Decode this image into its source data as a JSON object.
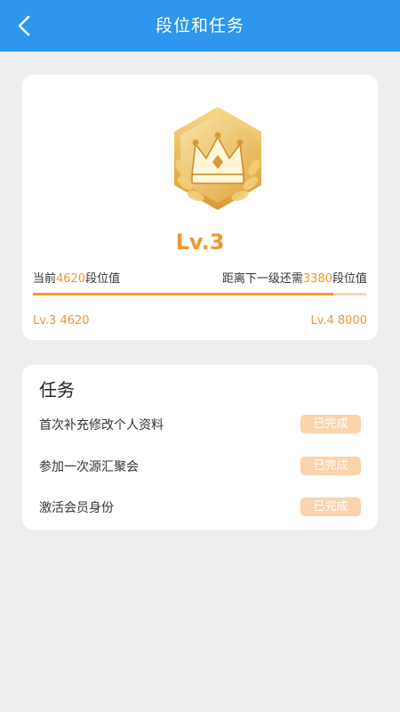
{
  "header": {
    "title": "段位和任务"
  },
  "level": {
    "name": "Lv.3",
    "current_prefix": "当前",
    "current_value": "4620",
    "current_suffix": "段位值",
    "next_prefix": "距离下一级还需",
    "next_value": "3380",
    "next_suffix": "段位值",
    "progress_fraction": 0.9,
    "min_label": "Lv.3 4620",
    "max_label": "Lv.4 8000"
  },
  "tasks": {
    "title": "任务",
    "items": [
      {
        "label": "首次补充修改个人资料",
        "status": "已完成"
      },
      {
        "label": "参加一次源汇聚会",
        "status": "已完成"
      },
      {
        "label": "激活会员身份",
        "status": "已完成"
      }
    ]
  },
  "colors": {
    "header_bg": "#2e96ec",
    "accent": "#f0972e",
    "status_bg": "#fbd3ac"
  },
  "icons": {
    "back": "chevron-left-icon",
    "badge": "crown-badge-icon"
  }
}
